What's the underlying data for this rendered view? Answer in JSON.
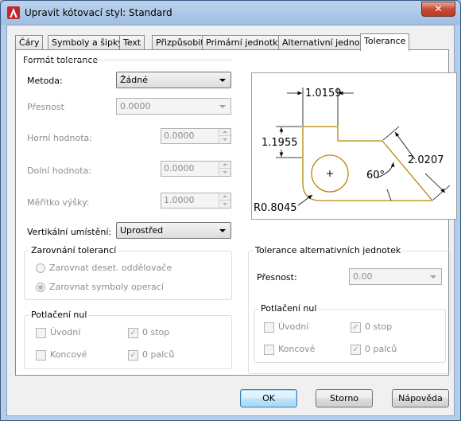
{
  "window": {
    "title": "Upravit kótovací styl: Standard",
    "close_glyph": "✕"
  },
  "tabs": [
    "Čáry",
    "Symboly a šipky",
    "Text",
    "Přizpůsobit",
    "Primární jednotky",
    "Alternativní jednotky",
    "Tolerance"
  ],
  "active_tab": "Tolerance",
  "format": {
    "title": "Formát tolerance",
    "method_label": "Metoda:",
    "method_value": "Žádné",
    "precision_label": "Přesnost",
    "precision_value": "0.0000",
    "upper_label": "Horní hodnota:",
    "upper_value": "0.0000",
    "lower_label": "Dolní hodnota:",
    "lower_value": "0.0000",
    "scale_label": "Měřítko výšky:",
    "scale_value": "1.0000",
    "vertical_label": "Vertikální umístění:",
    "vertical_value": "Uprostřed"
  },
  "alignment": {
    "title": "Zarovnání tolerancí",
    "opt1": "Zarovnat deset. oddělovače",
    "opt2": "Zarovnat symboly operací"
  },
  "zero_primary": {
    "title": "Potlačení nul",
    "leading": "Úvodní",
    "trailing": "Koncové",
    "feet": "0 stop",
    "inches": "0 palců"
  },
  "alt_tolerance": {
    "title": "Tolerance alternativních jednotek",
    "precision_label": "Přesnost:",
    "precision_value": "0.00",
    "zero_title": "Potlačení nul",
    "leading": "Úvodní",
    "trailing": "Koncové",
    "feet": "0 stop",
    "inches": "0 palců"
  },
  "preview": {
    "dim_top": "1.0159",
    "dim_left": "1.1955",
    "dim_right": "2.0207",
    "angle": "60°",
    "radius": "R0.8045"
  },
  "buttons": {
    "ok": "OK",
    "cancel": "Storno",
    "help": "Nápověda"
  },
  "colors": {
    "part_outline": "#b8860b",
    "accent": "#3c7fb1"
  }
}
